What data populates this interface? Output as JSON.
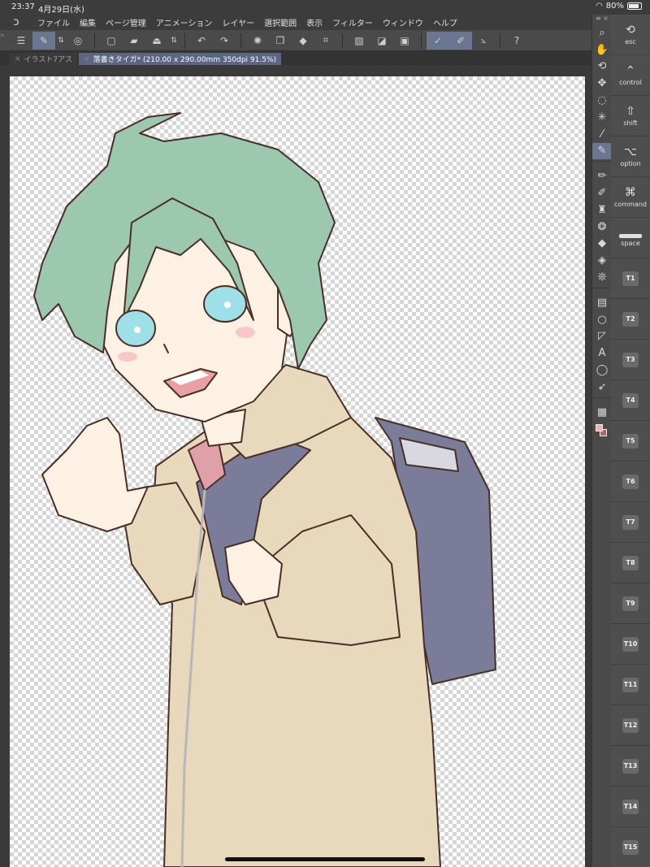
{
  "status": {
    "time": "23:37",
    "date": "4月29日(水)",
    "battery": "80%"
  },
  "menu": {
    "items": [
      "ファイル",
      "編集",
      "ページ管理",
      "アニメーション",
      "レイヤー",
      "選択範囲",
      "表示",
      "フィルター",
      "ウィンドウ",
      "ヘルプ"
    ]
  },
  "toolbar": {
    "icons": [
      "menu-icon",
      "layer-property-icon",
      "stepper-icon",
      "auto-select-icon",
      "new-file-icon",
      "open-icon",
      "save-icon",
      "stepper-icon",
      "undo-icon",
      "redo-icon",
      "busy-icon",
      "transform-icon",
      "fill-icon",
      "crop-icon",
      "clear-icon",
      "shade-icon",
      "frame-icon",
      "pen-stabilize-icon",
      "brush-icon",
      "ruler-snap-icon",
      "help-icon"
    ]
  },
  "tabs": [
    {
      "label": "イラスト7アス",
      "active": false
    },
    {
      "label": "落書きタイガ* (210.00 x 290.00mm 350dpi 91.5%)",
      "active": true
    }
  ],
  "tools": [
    "zoom-icon",
    "hand-icon",
    "rotate-icon",
    "move-icon",
    "lasso-select-icon",
    "magic-wand-icon",
    "eyedropper-icon",
    "pen-icon",
    "pencil-icon",
    "brush-icon",
    "airbrush-icon",
    "blend-icon",
    "eraser-icon",
    "fill-icon",
    "decoration-icon",
    "gradient-icon",
    "figure-icon",
    "frame-border-icon",
    "text-icon",
    "balloon-icon",
    "correct-line-icon",
    "layer-icon"
  ],
  "edge_keys": {
    "modifiers": [
      {
        "icon": "undo-arrow",
        "label": "esc"
      },
      {
        "icon": "caret-up",
        "label": "control"
      },
      {
        "icon": "shift-arrow",
        "label": "shift"
      },
      {
        "icon": "option-symbol",
        "label": "option"
      },
      {
        "icon": "command-symbol",
        "label": "command"
      },
      {
        "icon": "space-bar",
        "label": "space"
      }
    ],
    "shortcuts": [
      "T1",
      "T2",
      "T3",
      "T4",
      "T5",
      "T6",
      "T7",
      "T8",
      "T9",
      "T10",
      "T11",
      "T12",
      "T13",
      "T14",
      "T15"
    ]
  },
  "colors": {
    "hair": "#9cc8b0",
    "skin": "#fdf1e4",
    "hoodie": "#e8d8bc",
    "backpack": "#7a7c9a",
    "eyes": "#9fe0e8",
    "shirt": "#e0a0a8",
    "lineart": "#4a2e28",
    "accent": "#6b7690"
  }
}
